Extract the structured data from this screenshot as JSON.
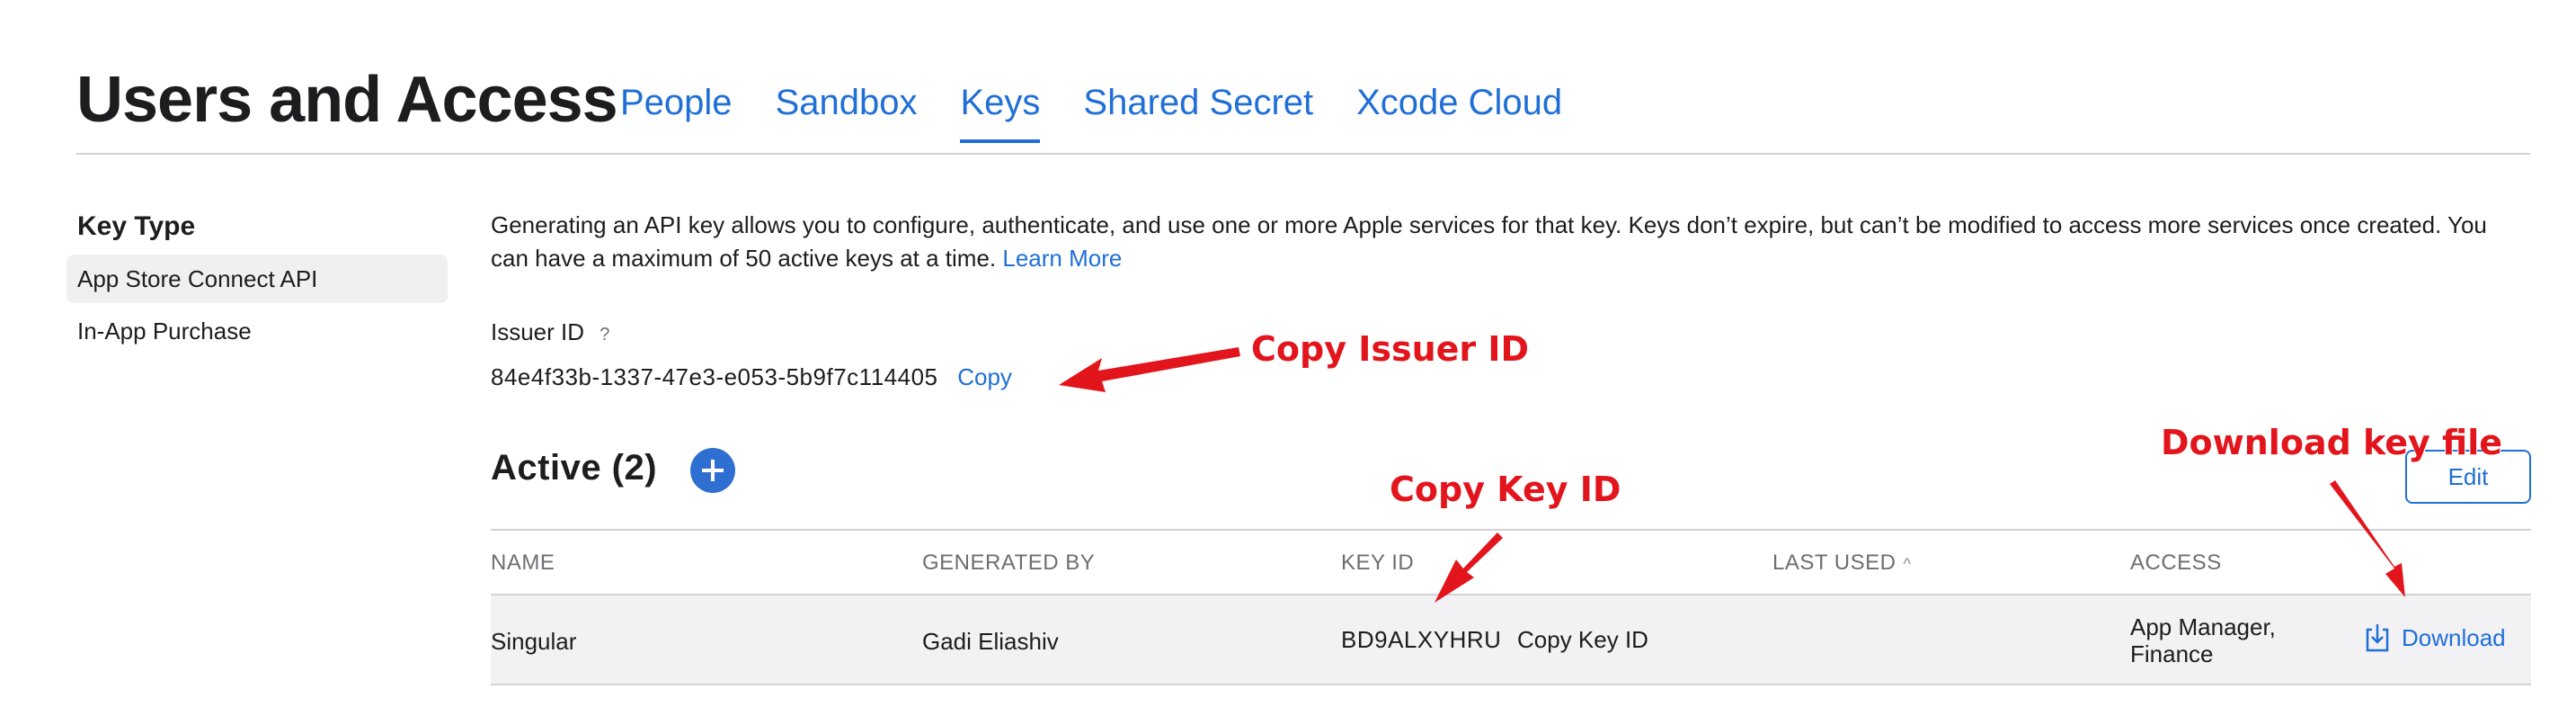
{
  "header": {
    "title": "Users and Access",
    "tabs": [
      {
        "label": "People"
      },
      {
        "label": "Sandbox"
      },
      {
        "label": "Keys",
        "active": true
      },
      {
        "label": "Shared Secret"
      },
      {
        "label": "Xcode Cloud"
      }
    ]
  },
  "sidebar": {
    "heading": "Key Type",
    "items": [
      {
        "label": "App Store Connect API",
        "selected": true
      },
      {
        "label": "In-App Purchase"
      }
    ]
  },
  "main": {
    "intro": "Generating an API key allows you to configure, authenticate, and use one or more Apple services for that key. Keys don’t expire, but can’t be modified to access more services once created. You can have a maximum of 50 active keys at a time.",
    "learn_more": "Learn More",
    "issuer": {
      "label": "Issuer ID",
      "help": "?",
      "value": "84e4f33b-1337-47e3-e053-5b9f7c114405",
      "copy": "Copy"
    },
    "active_title": "Active (2)",
    "edit_label": "Edit",
    "table": {
      "columns": [
        "NAME",
        "GENERATED BY",
        "KEY ID",
        "LAST USED",
        "ACCESS"
      ],
      "rows": [
        {
          "name": "Singular",
          "generated_by": "Gadi Eliashiv",
          "key_id": "BD9ALXYHRU",
          "copy_key_id": "Copy Key ID",
          "last_used": "",
          "access_line1": "App Manager,",
          "access_line2": "Finance",
          "download": "Download"
        }
      ]
    }
  },
  "annotations": {
    "copy_issuer": "Copy Issuer ID",
    "copy_key": "Copy Key ID",
    "download_key": "Download key file",
    "color": "#e3151c"
  },
  "colors": {
    "accent": "#1f6fd6",
    "row_bg": "#f2f2f4"
  }
}
